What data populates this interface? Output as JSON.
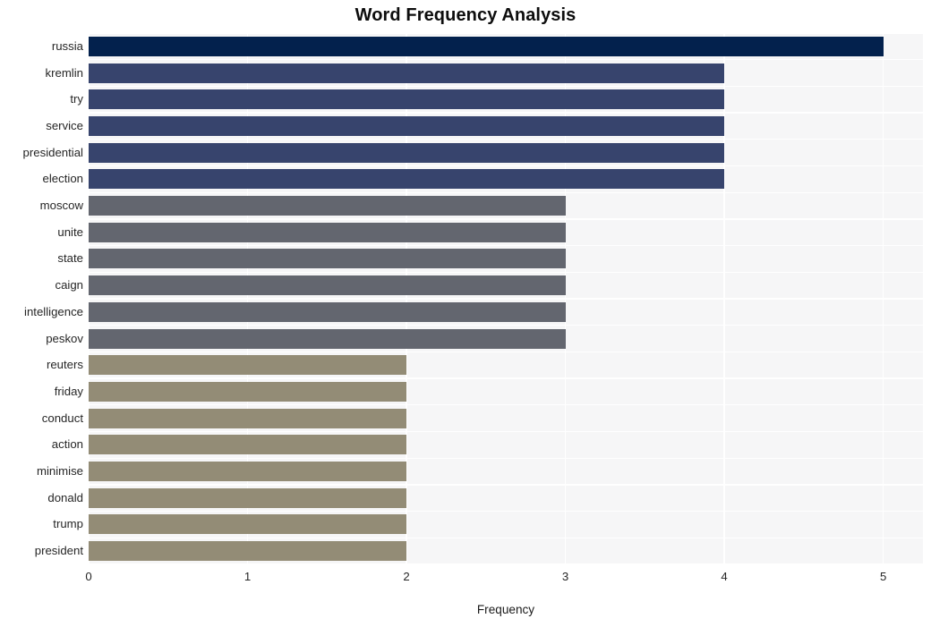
{
  "chart_data": {
    "type": "bar",
    "orientation": "horizontal",
    "title": "Word Frequency Analysis",
    "xlabel": "Frequency",
    "ylabel": "",
    "xlim": [
      0,
      5.25
    ],
    "xticks": [
      0,
      1,
      2,
      3,
      4,
      5
    ],
    "xtick_labels": [
      "0",
      "1",
      "2",
      "3",
      "4",
      "5"
    ],
    "grid": true,
    "grid_axis": "both",
    "grid_color": "#ffffff",
    "plot_background": "#f6f6f7",
    "figure_background": "#ffffff",
    "legend": null,
    "categories": [
      "russia",
      "kremlin",
      "try",
      "service",
      "presidential",
      "election",
      "moscow",
      "unite",
      "state",
      "caign",
      "intelligence",
      "peskov",
      "reuters",
      "friday",
      "conduct",
      "action",
      "minimise",
      "donald",
      "trump",
      "president"
    ],
    "values": [
      5,
      4,
      4,
      4,
      4,
      4,
      3,
      3,
      3,
      3,
      3,
      3,
      2,
      2,
      2,
      2,
      2,
      2,
      2,
      2
    ],
    "bar_colors": [
      "#03214d",
      "#37446d",
      "#37446d",
      "#37446d",
      "#37446d",
      "#37446d",
      "#63666f",
      "#63666f",
      "#63666f",
      "#63666f",
      "#63666f",
      "#63666f",
      "#938c76",
      "#938c76",
      "#938c76",
      "#938c76",
      "#938c76",
      "#938c76",
      "#938c76",
      "#938c76"
    ]
  }
}
